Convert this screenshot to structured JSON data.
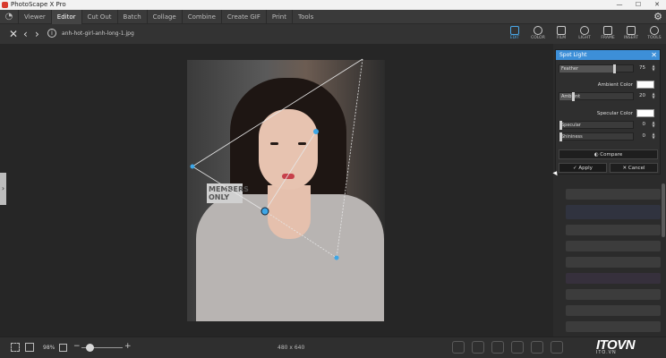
{
  "window": {
    "title": "PhotoScape X Pro",
    "controls": [
      "—",
      "☐",
      "✕"
    ]
  },
  "menu": {
    "items": [
      "Viewer",
      "Editor",
      "Cut Out",
      "Batch",
      "Collage",
      "Combine",
      "Create GIF",
      "Print",
      "Tools"
    ],
    "active": "Editor"
  },
  "file": {
    "name": "anh-hot-girl-anh-long-1.jpg"
  },
  "top_tabs": [
    {
      "label": "EDIT",
      "icon": "edit-icon",
      "active": true
    },
    {
      "label": "COLOR",
      "icon": "color-icon"
    },
    {
      "label": "FILM",
      "icon": "film-icon"
    },
    {
      "label": "LIGHT",
      "icon": "light-icon"
    },
    {
      "label": "FRAME",
      "icon": "frame-icon"
    },
    {
      "label": "INSERT",
      "icon": "insert-icon"
    },
    {
      "label": "TOOLS",
      "icon": "tools-icon"
    }
  ],
  "photo": {
    "sign_text": "MEMBERS ONLY"
  },
  "dialog": {
    "title": "Spot Light",
    "feather": {
      "label": "Feather",
      "value": "75",
      "level": 0.75
    },
    "ambient_color": {
      "label": "Ambient Color",
      "color": "#ffffff"
    },
    "ambient": {
      "label": "Ambient",
      "value": "20",
      "level": 0.2
    },
    "specular_color": {
      "label": "Specular Color",
      "color": "#ffffff"
    },
    "specular": {
      "label": "Specular",
      "value": "0",
      "level": 0
    },
    "shininess": {
      "label": "Shininess",
      "value": "0",
      "level": 0
    },
    "compare": "Compare",
    "apply": "Apply",
    "cancel": "Cancel"
  },
  "status": {
    "zoom": "98%",
    "dimensions": "480 x 640",
    "minus": "−",
    "plus": "+",
    "zoom_level": 0.1
  },
  "watermark": {
    "brand": "ITOVN",
    "sub": "ITO.VN"
  },
  "colors": {
    "accent": "#3d8fd8",
    "handle": "#3ea6e6"
  }
}
